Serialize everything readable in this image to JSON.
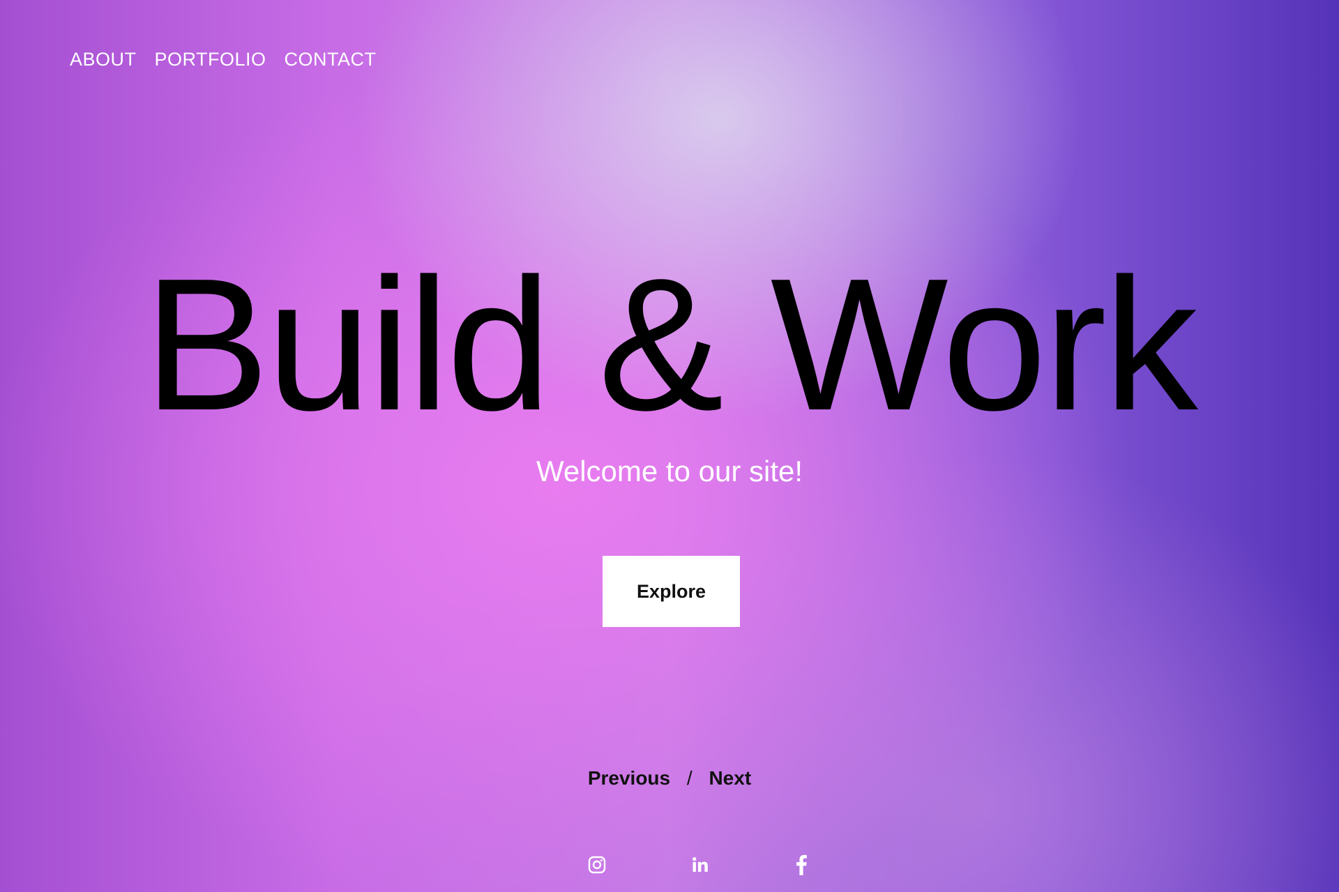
{
  "nav": {
    "items": [
      {
        "label": "ABOUT"
      },
      {
        "label": "PORTFOLIO"
      },
      {
        "label": "CONTACT"
      }
    ]
  },
  "hero": {
    "title": "Build & Work",
    "subtitle": "Welcome to our site!",
    "cta_label": "Explore"
  },
  "pager": {
    "previous_label": "Previous",
    "separator": "/",
    "next_label": "Next"
  },
  "social": {
    "icons": [
      "instagram-icon",
      "linkedin-icon",
      "facebook-icon"
    ]
  },
  "colors": {
    "title_text": "#000000",
    "nav_text": "#ffffff",
    "button_bg": "#ffffff"
  }
}
